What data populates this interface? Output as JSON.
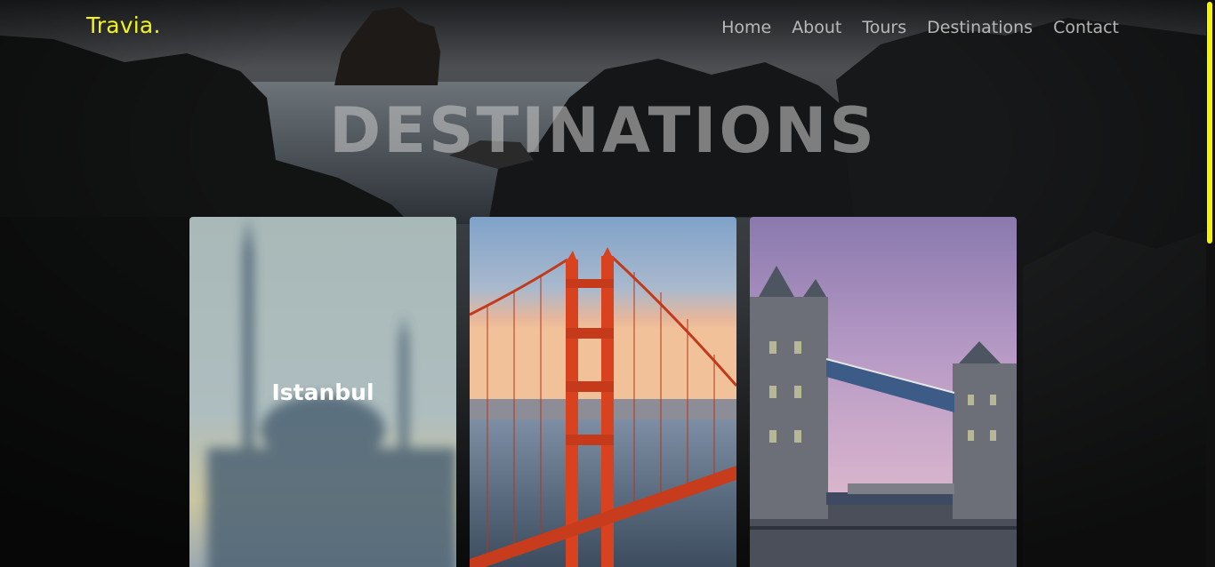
{
  "header": {
    "logo": "Travia.",
    "nav": [
      {
        "label": "Home"
      },
      {
        "label": "About"
      },
      {
        "label": "Tours"
      },
      {
        "label": "Destinations"
      },
      {
        "label": "Contact"
      }
    ]
  },
  "main": {
    "title": "DESTINATIONS",
    "cards": [
      {
        "label": "Istanbul",
        "image": "blue-mosque"
      },
      {
        "label": "",
        "image": "golden-gate-bridge"
      },
      {
        "label": "",
        "image": "tower-bridge"
      }
    ]
  },
  "colors": {
    "accent": "#f2f21e",
    "scrollbar_thumb": "#f5f500"
  }
}
